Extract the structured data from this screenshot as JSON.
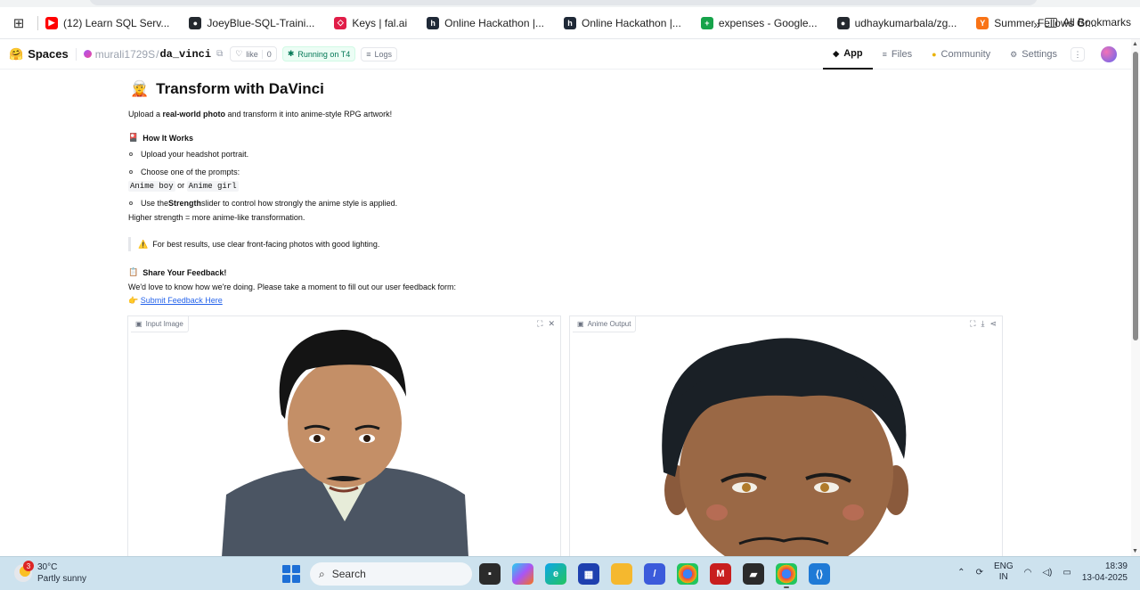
{
  "bookmarks": {
    "items": [
      {
        "label": "(12) Learn SQL Serv...",
        "icon": "youtube-icon",
        "color": "#ff0000"
      },
      {
        "label": "JoeyBlue-SQL-Traini...",
        "icon": "github-icon",
        "color": "#24292f"
      },
      {
        "label": "Keys | fal.ai",
        "icon": "fal-icon",
        "color": "#e11d48"
      },
      {
        "label": "Online Hackathon |...",
        "icon": "hackerearth-icon",
        "color": "#1f2937"
      },
      {
        "label": "Online Hackathon |...",
        "icon": "hackerearth-icon",
        "color": "#1f2937"
      },
      {
        "label": "expenses - Google...",
        "icon": "sheets-icon",
        "color": "#16a34a"
      },
      {
        "label": "udhaykumarbala/zg...",
        "icon": "github-icon",
        "color": "#24292f"
      },
      {
        "label": "Summer Fellows Gr...",
        "icon": "ycombinator-icon",
        "color": "#f97316"
      }
    ],
    "all_bookmarks": "All Bookmarks"
  },
  "header": {
    "brand": "Spaces",
    "owner": "murali1729S",
    "repo": "da_vinci",
    "like_label": "like",
    "like_count": "0",
    "status": "Running on T4",
    "logs": "Logs",
    "nav": [
      {
        "label": "App",
        "icon": "app-icon",
        "active": true
      },
      {
        "label": "Files",
        "icon": "files-icon",
        "active": false
      },
      {
        "label": "Community",
        "icon": "community-icon",
        "active": false
      },
      {
        "label": "Settings",
        "icon": "settings-icon",
        "active": false
      }
    ],
    "more": "⋮"
  },
  "page": {
    "title_emoji": "🧝",
    "title": "Transform with DaVinci",
    "intro_pre": "Upload a ",
    "intro_bold": "real-world photo",
    "intro_post": " and transform it into anime-style RPG artwork!",
    "how_heading": "How It Works",
    "how_emoji": "🎴",
    "step1": "Upload your headshot portrait.",
    "step2": "Choose one of the prompts:",
    "prompt_a": "Anime boy",
    "prompt_or": " or ",
    "prompt_b": "Anime girl",
    "step3_pre": "Use the ",
    "step3_bold": "Strength",
    "step3_post": " slider to control how strongly the anime style is applied.",
    "strength_note": "Higher strength = more anime-like transformation.",
    "tip_emoji": "⚠️",
    "tip": "For best results, use clear front-facing photos with good lighting.",
    "feedback_emoji": "📋",
    "feedback_heading": "Share Your Feedback!",
    "feedback_text": "We'd love to know how we're doing. Please take a moment to fill out our user feedback form:",
    "feedback_link_emoji": "👉",
    "feedback_link": "Submit Feedback Here"
  },
  "panels": {
    "input_label": "Input Image",
    "output_label": "Anime Output"
  },
  "taskbar": {
    "temp": "30°C",
    "weather": "Partly sunny",
    "weather_badge": "3",
    "search": "Search",
    "lang_top": "ENG",
    "lang_bottom": "IN",
    "time": "18:39",
    "date": "13-04-2025"
  }
}
